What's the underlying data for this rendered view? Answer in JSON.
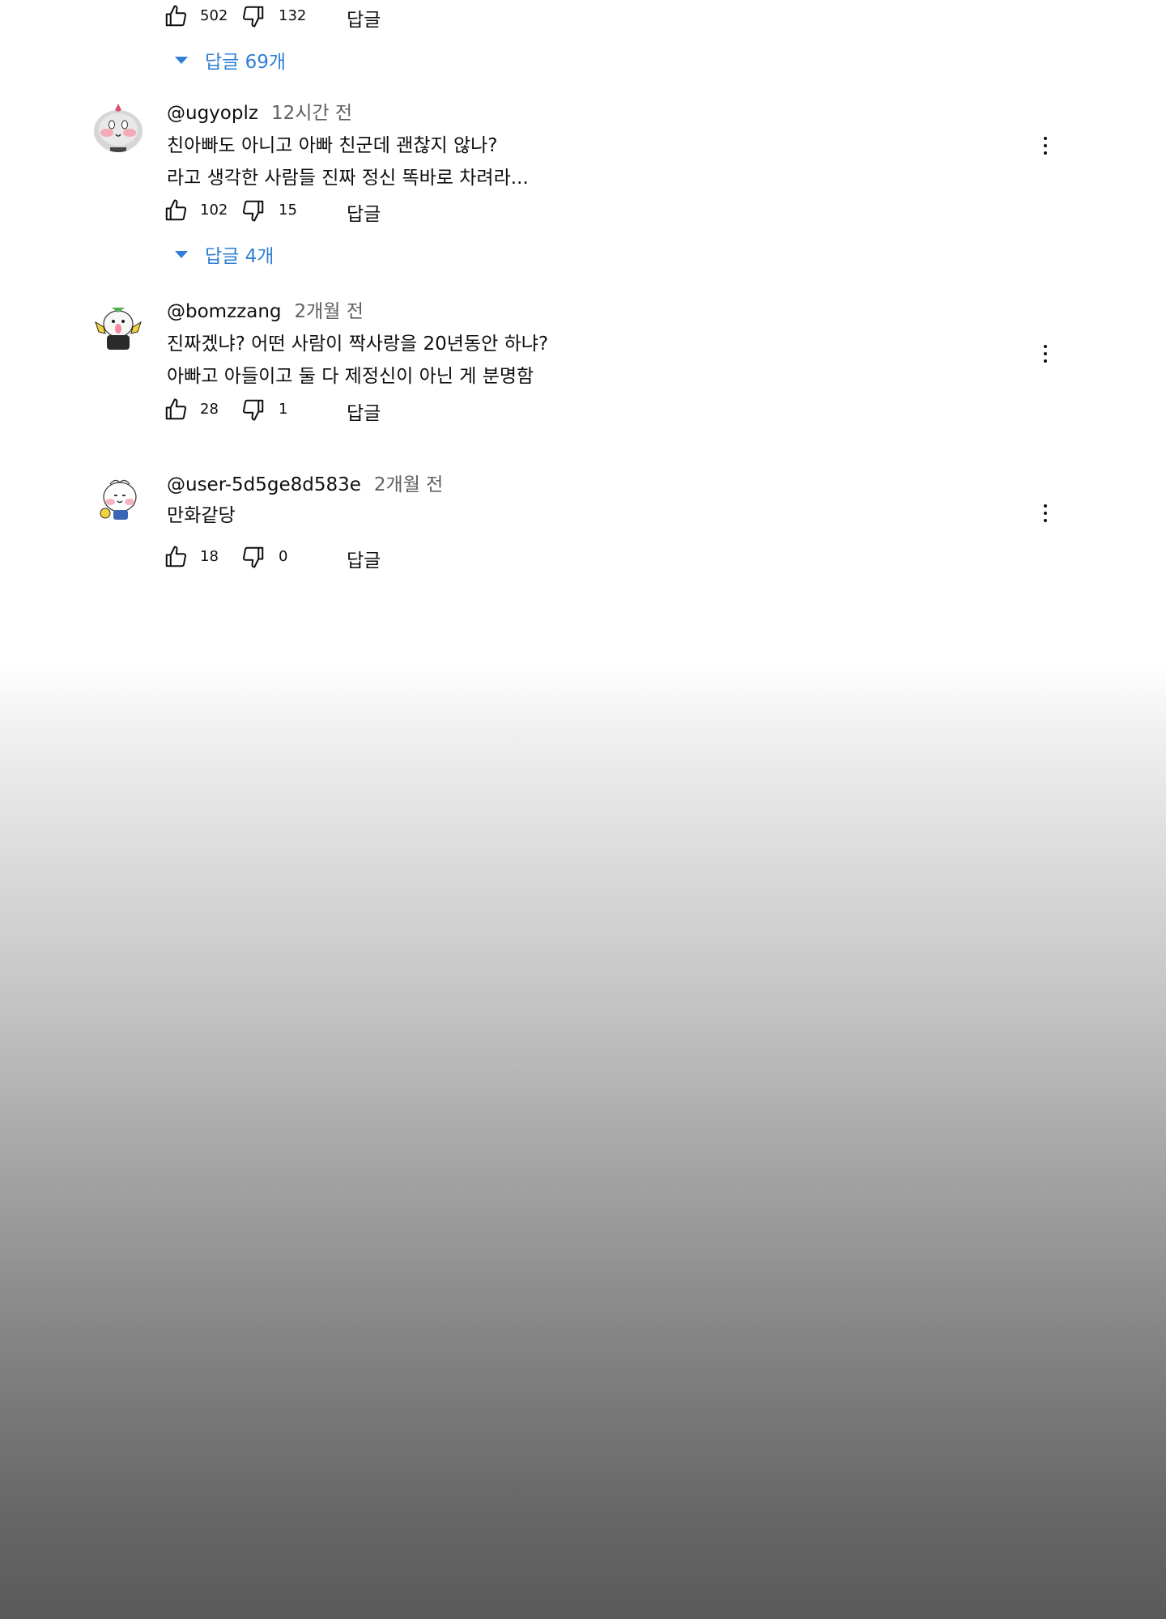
{
  "top_comment": {
    "likes": "502",
    "dislikes": "132",
    "reply_label": "답글",
    "replies_toggle": "답글 69개"
  },
  "comments": [
    {
      "author": "@ugyoplz",
      "time": "12시간 전",
      "lines": [
        "친아빠도 아니고 아빠 친군데 괜찮지 않나?",
        "라고 생각한 사람들 진짜 정신 똑바로 차려라..."
      ],
      "likes": "102",
      "dislikes": "15",
      "reply_label": "답글",
      "replies_toggle": "답글 4개"
    },
    {
      "author": "@bomzzang",
      "time": "2개월 전",
      "lines": [
        "진짜겠냐? 어떤 사람이 짝사랑을 20년동안 하냐?",
        "아빠고 아들이고 둘 다 제정신이 아닌 게 분명함"
      ],
      "likes": "28",
      "dislikes": "1",
      "reply_label": "답글"
    },
    {
      "author": "@user-5d5ge8d583e",
      "time": "2개월 전",
      "lines": [
        "만화같당"
      ],
      "likes": "18",
      "dislikes": "0",
      "reply_label": "답글"
    }
  ],
  "icons": {
    "like": "thumbs-up-icon",
    "dislike": "thumbs-down-icon",
    "more": "more-vertical-icon",
    "expand": "caret-down-icon"
  },
  "colors": {
    "link_blue": "#2f7fd6",
    "meta_gray": "#606060",
    "text": "#0f0f0f"
  }
}
